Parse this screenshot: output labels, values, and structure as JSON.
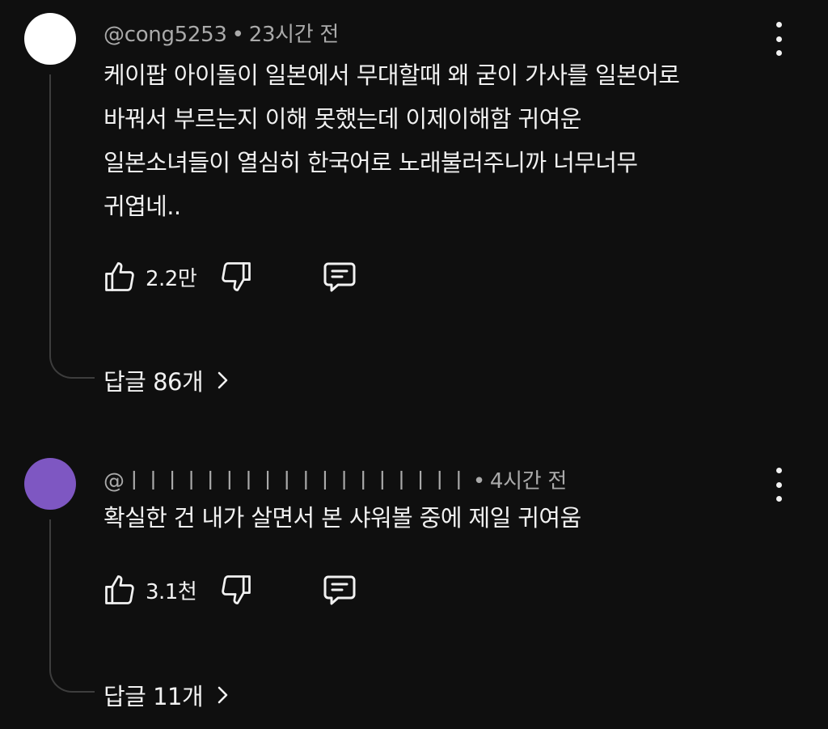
{
  "comments": [
    {
      "author": "@cong5253",
      "separator": "•",
      "time": "23시간 전",
      "avatar_color": "#ffffff",
      "lines": [
        "케이팝 아이돌이 일본에서 무대할때 왜 굳이 가사를 일본어로",
        "바꿔서 부르는지 이해 못했는데 이제이해함 귀여운",
        "일본소녀들이 열심히 한국어로 노래불러주니까 너무너무",
        "귀엽네.."
      ],
      "likes": "2.2만",
      "replies_label": "답글 86개"
    },
    {
      "author": "@ㅣㅣㅣㅣㅣㅣㅣㅣㅣㅣㅣㅣㅣㅣㅣㅣㅣㅣ",
      "separator": "•",
      "time": "4시간 전",
      "avatar_color": "#7e57c2",
      "lines": [
        "확실한 건 내가 살면서 본 샤워볼 중에 제일 귀여움"
      ],
      "likes": "3.1천",
      "replies_label": "답글 11개"
    }
  ],
  "icons": {
    "like": "thumbs-up-icon",
    "dislike": "thumbs-down-icon",
    "reply": "comment-icon",
    "more": "more-vert-icon",
    "expand": "chevron-right-icon"
  }
}
